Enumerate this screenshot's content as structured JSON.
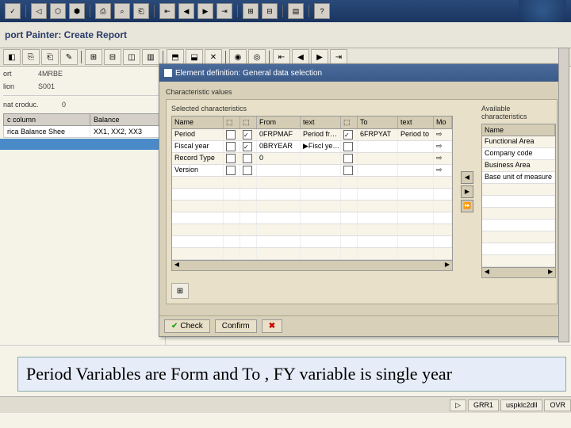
{
  "top_toolbar": {
    "buttons": [
      "↩",
      "▦",
      "⎘",
      "⎗",
      "⎙",
      "◉",
      "◎",
      "✂",
      "⧉",
      "≣",
      "⊞",
      "⊟",
      "▤",
      "▥",
      "?"
    ]
  },
  "title": "port Painter: Create Report",
  "toolbar2": {
    "buttons": [
      "◧",
      "⎘",
      "⎗",
      "✎",
      "⊞",
      "⊟",
      "◫",
      "▥",
      "⬒",
      "⬓",
      "✕",
      "◉",
      "◎",
      "⇤",
      "◀",
      "▶",
      "⇥"
    ]
  },
  "left": {
    "field1_label": "ort",
    "field1_value": "4MRBE",
    "field2_label": "lion",
    "field2_value": "S001",
    "field3_label": "nat croduc.",
    "field3_value": "0",
    "col_header1": "c column",
    "col_header2": "Balance",
    "row1_col1": "rica Balance Shee",
    "row1_col2": "XX1, XX2, XX3"
  },
  "dialog": {
    "title": "Element definition: General data selection",
    "section_chars": "Characteristic values",
    "section_selected": "Selected characteristics",
    "section_available": "Available characteristics",
    "sel_headers": [
      "Name",
      "",
      "",
      "From",
      "text",
      "",
      "To",
      "text",
      "Mo"
    ],
    "sel_rows": [
      {
        "name": "Period",
        "cb1": false,
        "cb2": true,
        "from": "0FRPMAF",
        "ftext": "Period fr…",
        "cb3": true,
        "to": "6FRPYAT",
        "ttext": "Period to",
        "arrow": "⇨"
      },
      {
        "name": "Fiscal year",
        "cb1": false,
        "cb2": true,
        "from": "0BRYEAR",
        "ftext": "▶Fiscl ye…",
        "cb3": false,
        "to": "",
        "ttext": "",
        "arrow": "⇨"
      },
      {
        "name": "Record Type",
        "cb1": false,
        "cb2": false,
        "from": "0",
        "ftext": "",
        "cb3": false,
        "to": "",
        "ttext": "",
        "arrow": "⇨"
      },
      {
        "name": "Version",
        "cb1": false,
        "cb2": false,
        "from": "",
        "ftext": "",
        "cb3": false,
        "to": "",
        "ttext": "",
        "arrow": "⇨"
      }
    ],
    "avail_header": "Name",
    "avail_rows": [
      "Functional Area",
      "Company code",
      "Business Area",
      "Base unit of measure"
    ],
    "check_label": "Check",
    "confirm_label": "Confirm"
  },
  "annotation": "Period Variables are Form and To , FY variable is single year",
  "status": {
    "cells": [
      "▷",
      "GRR1",
      "uspklc2dll",
      "OVR"
    ]
  }
}
